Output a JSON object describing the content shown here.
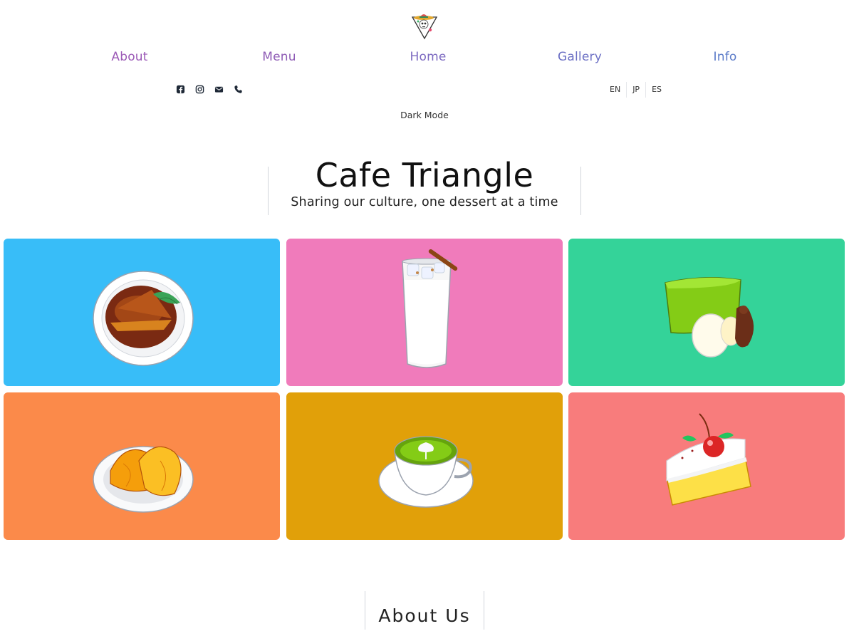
{
  "logo": {
    "icon": "sombrero-skull-triangle-icon"
  },
  "nav": {
    "items": [
      {
        "label": "About",
        "color": "#9b59b6"
      },
      {
        "label": "Menu",
        "color": "#8e5bb5"
      },
      {
        "label": "Home",
        "color": "#7b68c0"
      },
      {
        "label": "Gallery",
        "color": "#6b6fc4"
      },
      {
        "label": "Info",
        "color": "#5b7bc8"
      }
    ]
  },
  "social": {
    "icons": [
      "facebook-icon",
      "instagram-icon",
      "envelope-icon",
      "phone-icon"
    ],
    "color": "#1f2937"
  },
  "languages": [
    "EN",
    "JP",
    "ES"
  ],
  "dark_mode_label": "Dark Mode",
  "hero": {
    "title": "Cafe Triangle",
    "subtitle": "Sharing our culture, one dessert at a time"
  },
  "gallery": {
    "cards": [
      {
        "item": "flan-plate-icon",
        "bg": "#38bdf8"
      },
      {
        "item": "horchata-glass-icon",
        "bg": "#f07bbb"
      },
      {
        "item": "matcha-cake-icon",
        "bg": "#34d399"
      },
      {
        "item": "empanada-plate-icon",
        "bg": "#fb8a4a"
      },
      {
        "item": "matcha-latte-icon",
        "bg": "#e1a009"
      },
      {
        "item": "tres-leches-cake-icon",
        "bg": "#f87c7c"
      }
    ]
  },
  "about": {
    "title": "About Us"
  }
}
